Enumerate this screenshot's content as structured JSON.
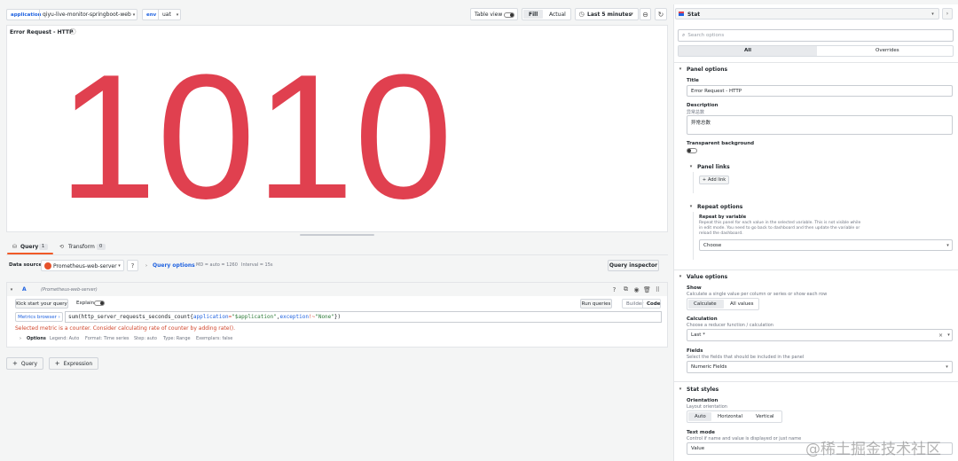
{
  "toolbar": {
    "application_label": "application",
    "application_value": "qiyu-live-monitor-springboot-web",
    "env_label": "env",
    "env_value": "uat",
    "table_view_label": "Table view",
    "fill_label": "Fill",
    "actual_label": "Actual",
    "time_range": "Last 5 minutes"
  },
  "panel": {
    "title": "Error Request - HTTP",
    "value": "1010",
    "value_color": "#e0404f"
  },
  "query_tabs": {
    "query_label": "Query",
    "query_count": "1",
    "transform_label": "Transform",
    "transform_count": "0"
  },
  "datasource": {
    "label": "Data source",
    "name": "Prometheus-web-server",
    "query_options": "Query options",
    "md": "MD = auto = 1260",
    "interval": "Interval = 15s",
    "inspector": "Query inspector"
  },
  "query": {
    "ref": "A",
    "ds_name": "(Prometheus-web-server)",
    "kick_start": "Kick start your query",
    "explain": "Explain",
    "run": "Run queries",
    "builder": "Builder",
    "code": "Code",
    "metrics_browser": "Metrics browser ›",
    "expr_func": "sum(http_server_requests_seconds_count{",
    "expr_k1": "application",
    "expr_op1": "=",
    "expr_v1": "\"$application\"",
    "expr_comma": ",",
    "expr_k2": "exception",
    "expr_op2": "!~",
    "expr_v2": "\"None\"",
    "expr_end": "})",
    "warning": "Selected metric is a counter. Consider calculating rate of counter by adding rate().",
    "options_label": "Options",
    "legend": "Legend: Auto",
    "format": "Format: Time series",
    "step": "Step: auto",
    "type": "Type: Range",
    "exemplars": "Exemplars: false"
  },
  "bottom_buttons": {
    "add_query": "Query",
    "add_expression": "Expression"
  },
  "options_pane": {
    "viz": "Stat",
    "search_placeholder": "Search options",
    "tab_all": "All",
    "tab_overrides": "Overrides",
    "panel_options": "Panel options",
    "title_label": "Title",
    "title_value": "Error Request - HTTP",
    "description_label": "Description",
    "description_sub": "异常总数",
    "description_value": "异常总数",
    "transparent_label": "Transparent background",
    "panel_links": "Panel links",
    "add_link": "Add link",
    "repeat_options": "Repeat options",
    "repeat_by": "Repeat by variable",
    "repeat_desc1": "Repeat this panel for each value in the selected variable. This is not visible while",
    "repeat_desc2": "in edit mode. You need to go back to dashboard and then update the variable or",
    "repeat_desc3": "reload the dashboard.",
    "choose": "Choose",
    "value_options": "Value options",
    "show_label": "Show",
    "show_desc": "Calculate a single value per column or series or show each row",
    "calculate": "Calculate",
    "all_values": "All values",
    "calculation_label": "Calculation",
    "calculation_desc": "Choose a reducer function / calculation",
    "calculation_value": "Last *",
    "fields_label": "Fields",
    "fields_desc": "Select the fields that should be included in the panel",
    "fields_value": "Numeric Fields",
    "stat_styles": "Stat styles",
    "orientation_label": "Orientation",
    "orientation_desc": "Layout orientation",
    "auto": "Auto",
    "horizontal": "Horizontal",
    "vertical": "Vertical",
    "text_mode_label": "Text mode",
    "text_mode_desc": "Control if name and value is displayed or just name",
    "text_mode_value": "Value"
  },
  "watermark": "@稀土掘金技术社区"
}
